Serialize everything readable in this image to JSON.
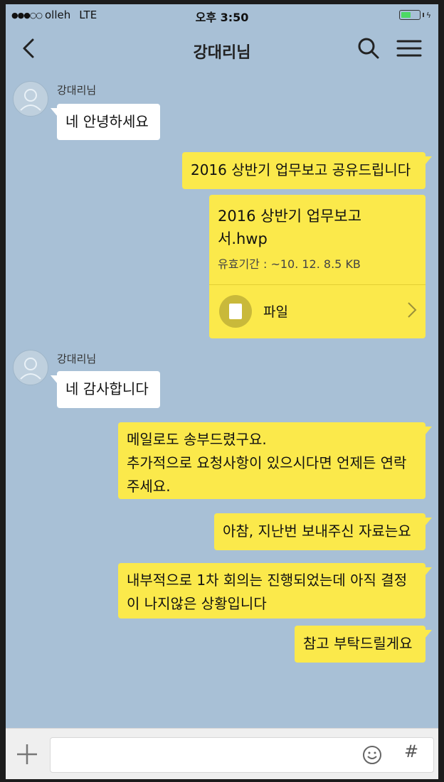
{
  "status_bar": {
    "signal_dots": "●●●○○",
    "carrier": "olleh",
    "network": "LTE",
    "time": "오후 3:50",
    "charging_symbol": "ϟ"
  },
  "header": {
    "title": "강대리님"
  },
  "messages": [
    {
      "sender": "강대리님",
      "side": "left",
      "text": "네 안녕하세요"
    },
    {
      "side": "right",
      "text": "2016 상반기 업무보고 공유드립니다"
    },
    {
      "side": "right",
      "type": "file",
      "file_name_line1": "2016 상반기 업무보고",
      "file_name_line2": "서.hwp",
      "file_meta": "유효기간 : ~10. 12.    8.5 KB",
      "file_label": "파일"
    },
    {
      "sender": "강대리님",
      "side": "left",
      "text": "네 감사합니다"
    },
    {
      "side": "right",
      "line1": "메일로도 송부드렸구요.",
      "line2": "추가적으로 요청사항이 있으시다면 언제든 연락",
      "line3": "주세요."
    },
    {
      "side": "right",
      "text": "아참, 지난번 보내주신 자료는요"
    },
    {
      "side": "right",
      "line1": "내부적으로 1차 회의는 진행되었는데 아직 결정",
      "line2": "이 나지않은 상황입니다"
    },
    {
      "side": "right",
      "text": "참고 부탁드릴게요"
    }
  ],
  "input_bar": {
    "message_value": "",
    "hash_label": "#"
  },
  "colors": {
    "chat_background": "#a8c0d6",
    "my_bubble": "#fbe94b",
    "their_bubble": "#ffffff",
    "input_bar": "#efefef"
  },
  "icons": [
    "back-arrow-icon",
    "search-icon",
    "menu-icon",
    "avatar-placeholder-icon",
    "document-icon",
    "chevron-right-icon",
    "plus-icon",
    "emoji-icon",
    "hash-icon",
    "battery-icon"
  ]
}
